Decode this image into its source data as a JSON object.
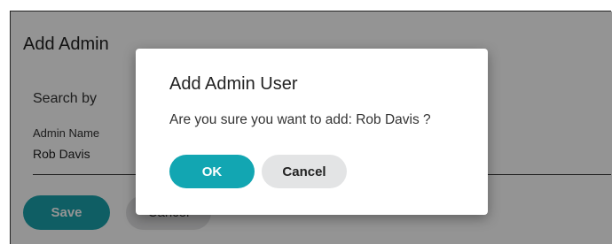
{
  "page": {
    "title": "Add Admin",
    "search_by_label": "Search by",
    "field": {
      "label": "Admin Name",
      "value": "Rob Davis"
    },
    "save_label": "Save",
    "cancel_label": "Cancel"
  },
  "dialog": {
    "title": "Add Admin User",
    "message": "Are you sure you want to add: Rob Davis ?",
    "ok_label": "OK",
    "cancel_label": "Cancel"
  },
  "colors": {
    "accent": "#12a6b2",
    "secondary_button": "#e3e4e5"
  }
}
